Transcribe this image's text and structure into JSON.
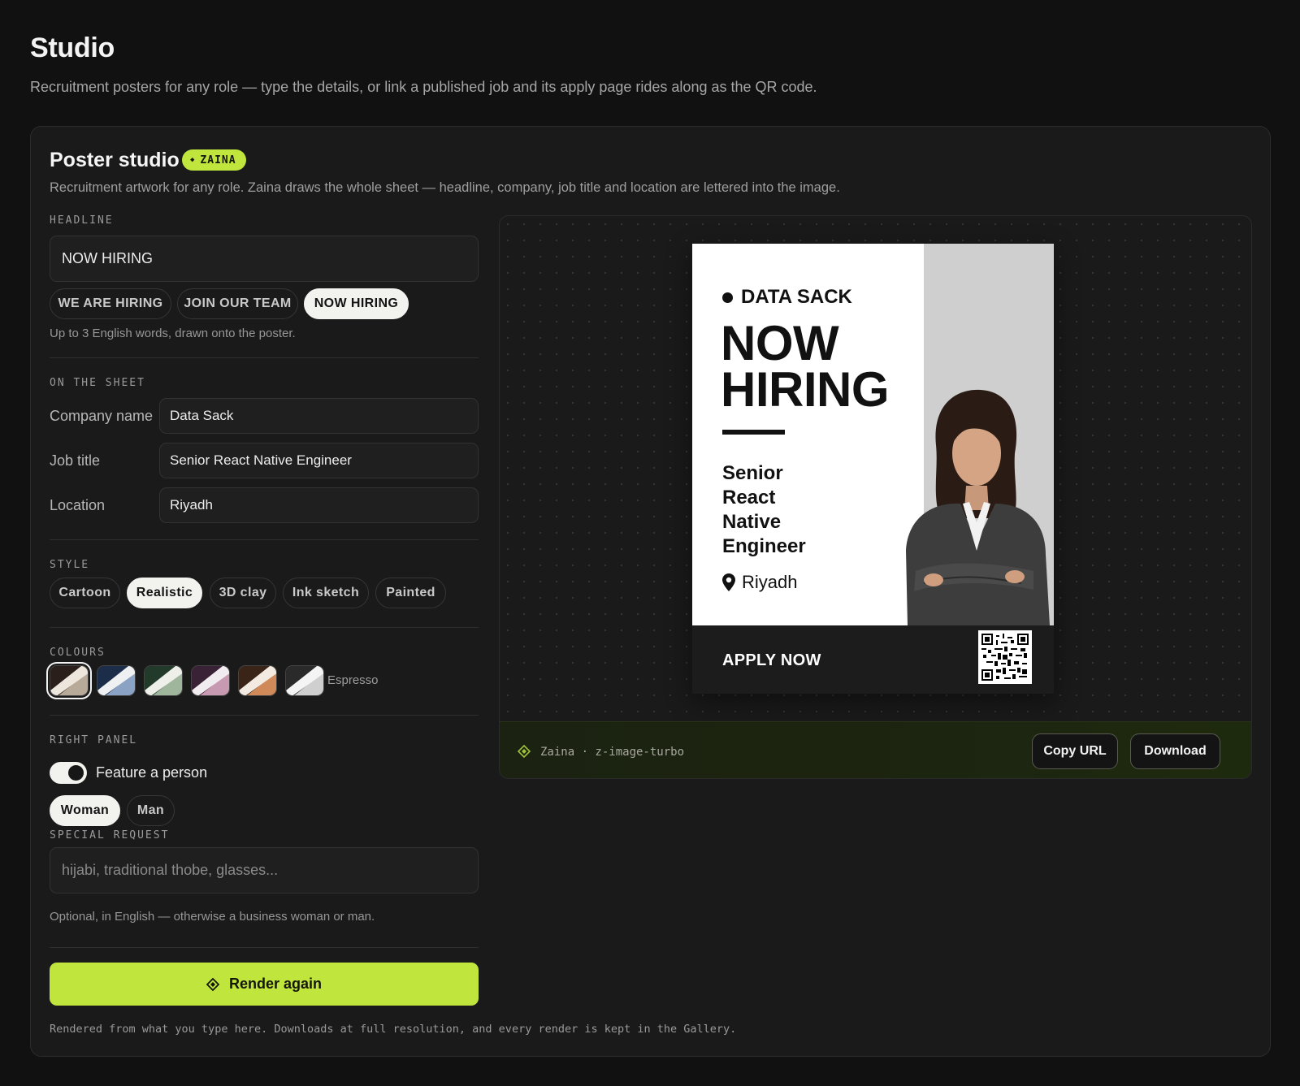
{
  "page": {
    "title": "Studio",
    "subtitle": "Recruitment posters for any role — type the details, or link a published job and its apply page rides along as the QR code."
  },
  "studio": {
    "title": "Poster studio",
    "badge": "ZAINA",
    "description": "Recruitment artwork for any role. Zaina draws the whole sheet — headline, company, job title and location are lettered into the image."
  },
  "headline": {
    "label": "HEADLINE",
    "value": "NOW HIRING",
    "presets": [
      "WE ARE HIRING",
      "JOIN OUR TEAM",
      "NOW HIRING"
    ],
    "selected": "NOW HIRING",
    "hint": "Up to 3 English words, drawn onto the poster."
  },
  "sheet": {
    "label": "ON THE SHEET",
    "company_label": "Company name",
    "company_value": "Data Sack",
    "job_label": "Job title",
    "job_value": "Senior React Native Engineer",
    "location_label": "Location",
    "location_value": "Riyadh"
  },
  "style": {
    "label": "STYLE",
    "options": [
      "Cartoon",
      "Realistic",
      "3D clay",
      "Ink sketch",
      "Painted"
    ],
    "selected": "Realistic"
  },
  "colours": {
    "label": "COLOURS",
    "selected_name": "Espresso",
    "swatches": [
      {
        "a": "#2b1f1b",
        "b": "#ece6dc",
        "c": "#b8aa98"
      },
      {
        "a": "#1c2d4a",
        "b": "#eef0f2",
        "c": "#8aa3c4"
      },
      {
        "a": "#213a29",
        "b": "#eeefe8",
        "c": "#9fb59c"
      },
      {
        "a": "#3a2236",
        "b": "#f1ecef",
        "c": "#c79ab1"
      },
      {
        "a": "#3a2418",
        "b": "#f3ebe2",
        "c": "#d08a5a"
      },
      {
        "a": "#2a2a2a",
        "b": "#f4f4f4",
        "c": "#cfcfcf"
      }
    ]
  },
  "right_panel": {
    "label": "RIGHT PANEL",
    "toggle_label": "Feature a person",
    "toggle_on": true,
    "genders": [
      "Woman",
      "Man"
    ],
    "selected": "Woman"
  },
  "special": {
    "label": "SPECIAL REQUEST",
    "placeholder": "hijabi, traditional thobe, glasses...",
    "hint": "Optional, in English — otherwise a business woman or man."
  },
  "actions": {
    "render_label": "Render again",
    "footnote": "Rendered from what you type here. Downloads at full resolution, and every render is kept in the Gallery."
  },
  "poster": {
    "brand": "DATA SACK",
    "headline_line1": "NOW",
    "headline_line2": "HIRING",
    "job_lines": [
      "Senior",
      "React",
      "Native",
      "Engineer"
    ],
    "location": "Riyadh",
    "apply": "APPLY NOW"
  },
  "preview_bar": {
    "model": "Zaina · z-image-turbo",
    "copy_label": "Copy URL",
    "download_label": "Download"
  },
  "colors": {
    "accent": "#c0e53d",
    "background": "#111111",
    "card": "#1a1a1a"
  }
}
